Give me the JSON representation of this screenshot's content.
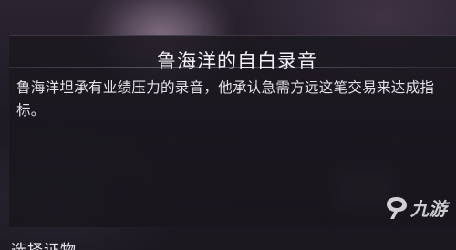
{
  "dialog": {
    "title": "鲁海洋的自白录音",
    "body": "鲁海洋坦承有业绩压力的录音，他承认急需方远这笔交易来达成指标。"
  },
  "section_label": "选择证物",
  "watermark": {
    "text": "九游",
    "icon": "jiuyou-logo-icon"
  }
}
